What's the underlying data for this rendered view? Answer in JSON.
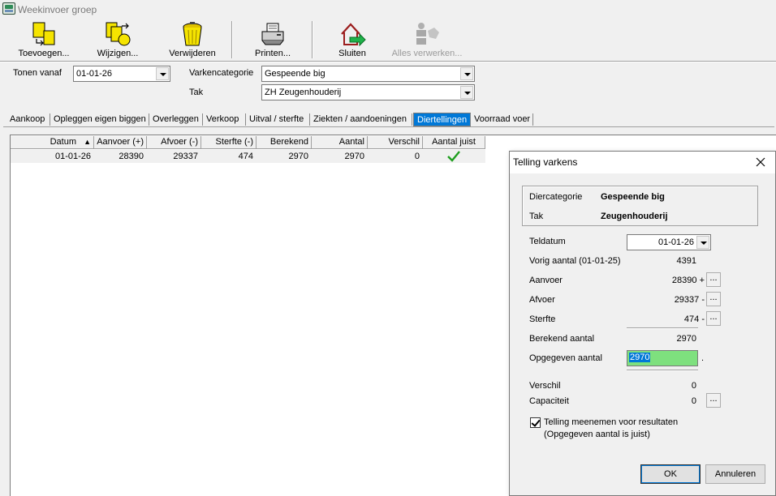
{
  "window": {
    "title": "Weekinvoer groep"
  },
  "toolbar": {
    "add": "Toevoegen...",
    "edit": "Wijzigen...",
    "delete": "Verwijderen",
    "print": "Printen...",
    "close": "Sluiten",
    "process_all": "Alles verwerken..."
  },
  "filters": {
    "from_label": "Tonen vanaf",
    "from_value": "01-01-26",
    "category_label": "Varkencategorie",
    "category_value": "Gespeende big",
    "branch_label": "Tak",
    "branch_value": "ZH  Zeugenhouderij"
  },
  "tabs": [
    "Aankoop",
    "Opleggen eigen biggen",
    "Overleggen",
    "Verkoop",
    "Uitval / sterfte",
    "Ziekten / aandoeningen",
    "Diertellingen",
    "Voorraad voer"
  ],
  "active_tab": "Diertellingen",
  "grid": {
    "columns": [
      "Datum",
      "Aanvoer (+)",
      "Afvoer (-)",
      "Sterfte (-)",
      "Berekend",
      "Aantal",
      "Verschil",
      "Aantal juist"
    ],
    "sort_indicator": "▲",
    "rows": [
      {
        "datum": "01-01-26",
        "aanvoer": "28390",
        "afvoer": "29337",
        "sterfte": "474",
        "berekend": "2970",
        "aantal": "2970",
        "verschil": "0",
        "aantal_juist": "check-icon"
      }
    ]
  },
  "dialog": {
    "title": "Telling varkens",
    "category_label": "Diercategorie",
    "category_value": "Gespeende big",
    "branch_label": "Tak",
    "branch_value": "Zeugenhouderij",
    "count_date_label": "Teldatum",
    "count_date_value": "01-01-26",
    "prev_label": "Vorig aantal (01-01-25)",
    "prev_value": "4391",
    "supply_label": "Aanvoer",
    "supply_value": "28390 +",
    "removal_label": "Afvoer",
    "removal_value": "29337 -",
    "death_label": "Sterfte",
    "death_value": "474 -",
    "calculated_label": "Berekend aantal",
    "calculated_value": "2970",
    "given_label": "Opgegeven aantal",
    "given_value": "2970",
    "given_suffix": ".",
    "difference_label": "Verschil",
    "difference_value": "0",
    "capacity_label": "Capaciteit",
    "capacity_value": "0",
    "dots": "...",
    "checkbox_label_1": "Telling meenemen voor resultaten",
    "checkbox_label_2": "(Opgegeven aantal is juist)",
    "checkbox_checked": true,
    "ok": "OK",
    "cancel": "Annuleren"
  },
  "colors": {
    "accent": "#0078d7",
    "input_highlight": "#7ee07e",
    "check": "#1e9e1e"
  }
}
